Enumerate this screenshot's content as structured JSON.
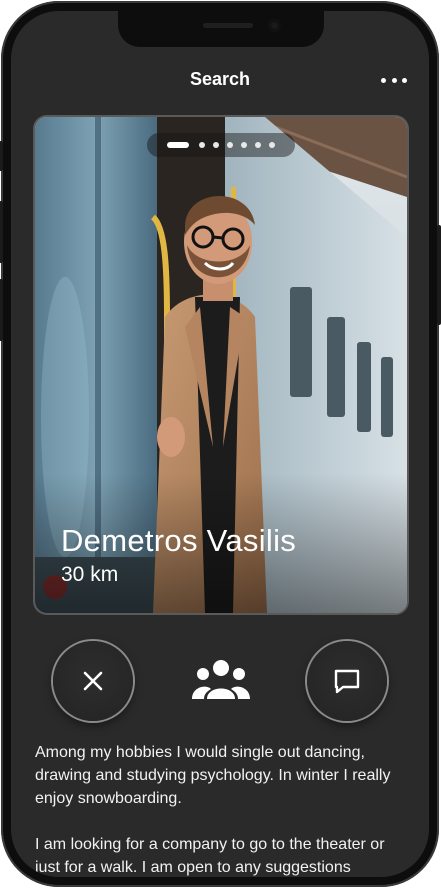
{
  "header": {
    "title": "Search",
    "menu_icon": "more-horizontal-icon"
  },
  "profile": {
    "name": "Demetros Vasilis",
    "distance": "30 km",
    "photo_count": 7,
    "current_photo": 1
  },
  "actions": {
    "dismiss_icon": "close-icon",
    "group_icon": "people-group-icon",
    "chat_icon": "message-square-icon"
  },
  "bio": {
    "paragraph_1": "Among my hobbies I would single out dancing, drawing and studying psychology. In winter I really enjoy snowboarding.",
    "paragraph_2": "I am looking for a company to go to the theater or just for a walk. I am open to any suggestions"
  },
  "colors": {
    "screen_background": "#2a2a2a",
    "phone_frame": "#0d0d0d",
    "text": "#ffffff"
  }
}
